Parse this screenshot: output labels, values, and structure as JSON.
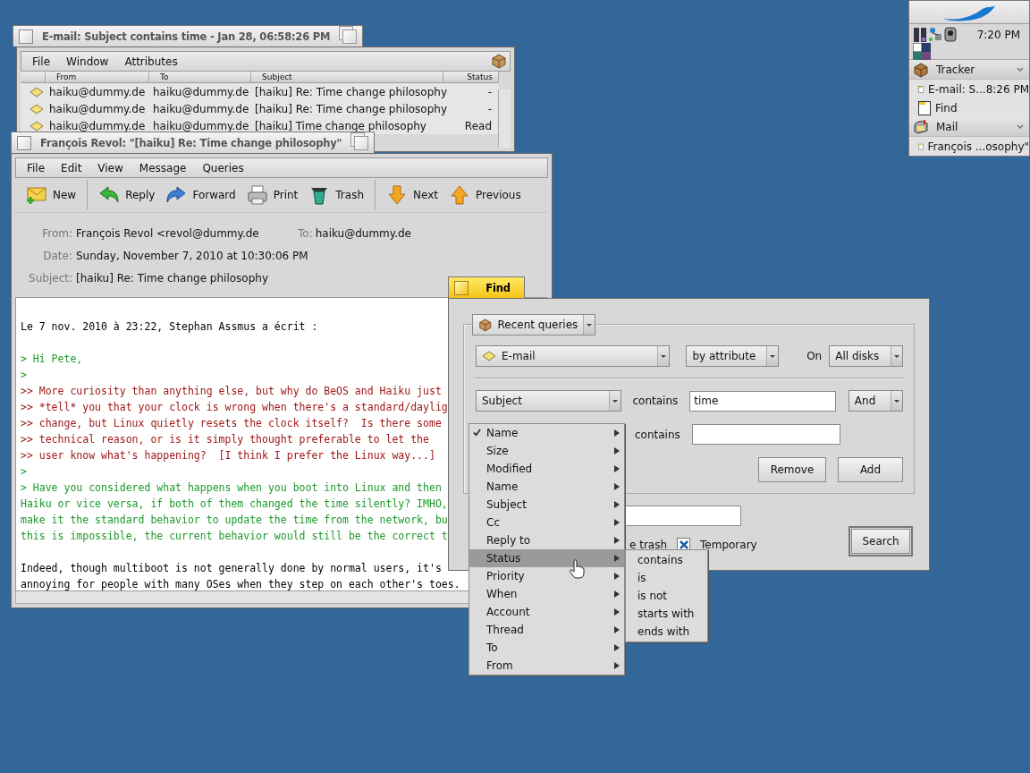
{
  "query_window": {
    "title": "E-mail: Subject contains time - Jan 28, 06:58:26 PM",
    "active": false,
    "menu": [
      "File",
      "Window",
      "Attributes"
    ],
    "columns": [
      "From",
      "To",
      "Subject",
      "Status"
    ],
    "rows": [
      {
        "from": "haiku@dummy.de",
        "to": "haiku@dummy.de",
        "subject": "[haiku] Re: Time change philosophy",
        "status": "-"
      },
      {
        "from": "haiku@dummy.de",
        "to": "haiku@dummy.de",
        "subject": "[haiku] Re: Time change philosophy",
        "status": "-"
      },
      {
        "from": "haiku@dummy.de",
        "to": "haiku@dummy.de",
        "subject": "[haiku] Time change philosophy",
        "status": "Read"
      }
    ]
  },
  "mail_window": {
    "title": "François Revol: \"[haiku] Re: Time change philosophy\"",
    "active": false,
    "menu": [
      "File",
      "Edit",
      "View",
      "Message",
      "Queries"
    ],
    "toolbar": [
      {
        "buttons": [
          {
            "label": "New",
            "kind": "new"
          }
        ]
      },
      {
        "buttons": [
          {
            "label": "Reply",
            "kind": "reply"
          },
          {
            "label": "Forward",
            "kind": "forward"
          },
          {
            "label": "Print",
            "kind": "print"
          },
          {
            "label": "Trash",
            "kind": "trash"
          }
        ]
      },
      {
        "buttons": [
          {
            "label": "Next",
            "kind": "next"
          },
          {
            "label": "Previous",
            "kind": "previous"
          }
        ]
      }
    ],
    "header": {
      "from_label": "From:",
      "from": "François Revol <revol@dummy.de",
      "to_label": "To:",
      "to": "haiku@dummy.de",
      "date_label": "Date:",
      "date": "Sunday, November 7, 2010 at 10:30:06 PM",
      "subject_label": "Subject:",
      "subject": "[haiku] Re: Time change philosophy"
    },
    "body": [
      {
        "lines": [
          {
            "kind": "plain",
            "text": "Le 7 nov. 2010 à 23:22, Stephan Assmus a écrit :"
          }
        ]
      },
      {
        "lines": [
          {
            "kind": "quote",
            "text": "> Hi Pete,"
          },
          {
            "kind": "quote",
            "text": ">"
          },
          {
            "kind": "quote2",
            "text": ">> More curiosity than anything else, but why do BeOS and Haiku just"
          },
          {
            "kind": "quote2",
            "text": ">> *tell* you that your clock is wrong when there's a standard/daylig"
          },
          {
            "kind": "quote2",
            "text": ">> change, but Linux quietly resets the clock itself?  Is there some"
          },
          {
            "kind": "quote2",
            "text": ">> technical reason, or is it simply thought preferable to let the"
          },
          {
            "kind": "quote2",
            "text": ">> user know what's happening?  [I think I prefer the Linux way...]"
          },
          {
            "kind": "quote",
            "text": ">"
          },
          {
            "kind": "quote",
            "text": "> Have you considered what happens when you boot into Linux and then"
          },
          {
            "kind": "quote",
            "text": "Haiku or vice versa, if both of them changed the time silently? IMHO,"
          },
          {
            "kind": "quote",
            "text": "make it the standard behavior to update the time from the network, bu"
          },
          {
            "kind": "quote",
            "text": "this is impossible, the current behavior would still be the correct t"
          }
        ]
      },
      {
        "lines": [
          {
            "kind": "plain",
            "text": "Indeed, though multiboot is not generally done by normal users, it's"
          },
          {
            "kind": "plain",
            "text": "annoying for people with many OSes when they step on each other's toes."
          }
        ]
      }
    ]
  },
  "find_window": {
    "title": "Find",
    "active": true,
    "recent_queries": "Recent queries",
    "type": "E-mail",
    "method": "by attribute",
    "on_label": "On",
    "volume": "All disks",
    "attribute": "Subject",
    "operator": "contains",
    "value": "time",
    "conjunction": "And",
    "operator_2": "contains",
    "remove": "Remove",
    "add": "Add",
    "trash_label": "e trash",
    "temporary": {
      "label": "Temporary",
      "checked": true
    },
    "search": "Search"
  },
  "attribute_menu": {
    "items": [
      {
        "label": "Name",
        "checked": true,
        "selected": false
      },
      {
        "label": "Size",
        "checked": false,
        "selected": false
      },
      {
        "label": "Modified",
        "checked": false,
        "selected": false
      },
      {
        "label": "Name",
        "checked": false,
        "selected": false
      },
      {
        "label": "Subject",
        "checked": false,
        "selected": false
      },
      {
        "label": "Cc",
        "checked": false,
        "selected": false
      },
      {
        "label": "Reply to",
        "checked": false,
        "selected": false
      },
      {
        "label": "Status",
        "checked": false,
        "selected": true
      },
      {
        "label": "Priority",
        "checked": false,
        "selected": false
      },
      {
        "label": "When",
        "checked": false,
        "selected": false
      },
      {
        "label": "Account",
        "checked": false,
        "selected": false
      },
      {
        "label": "Thread",
        "checked": false,
        "selected": false
      },
      {
        "label": "To",
        "checked": false,
        "selected": false
      },
      {
        "label": "From",
        "checked": false,
        "selected": false
      }
    ]
  },
  "operator_menu": {
    "items": [
      "contains",
      "is",
      "is not",
      "starts with",
      "ends with"
    ]
  },
  "deskbar": {
    "clock": "7:20 PM",
    "apps": [
      {
        "name": "Tracker",
        "kind": "tracker",
        "windows": [
          "E-mail: S...8:26 PM",
          "Find"
        ]
      },
      {
        "name": "Mail",
        "kind": "mail",
        "windows": [
          "François ...osophy\""
        ]
      }
    ]
  }
}
